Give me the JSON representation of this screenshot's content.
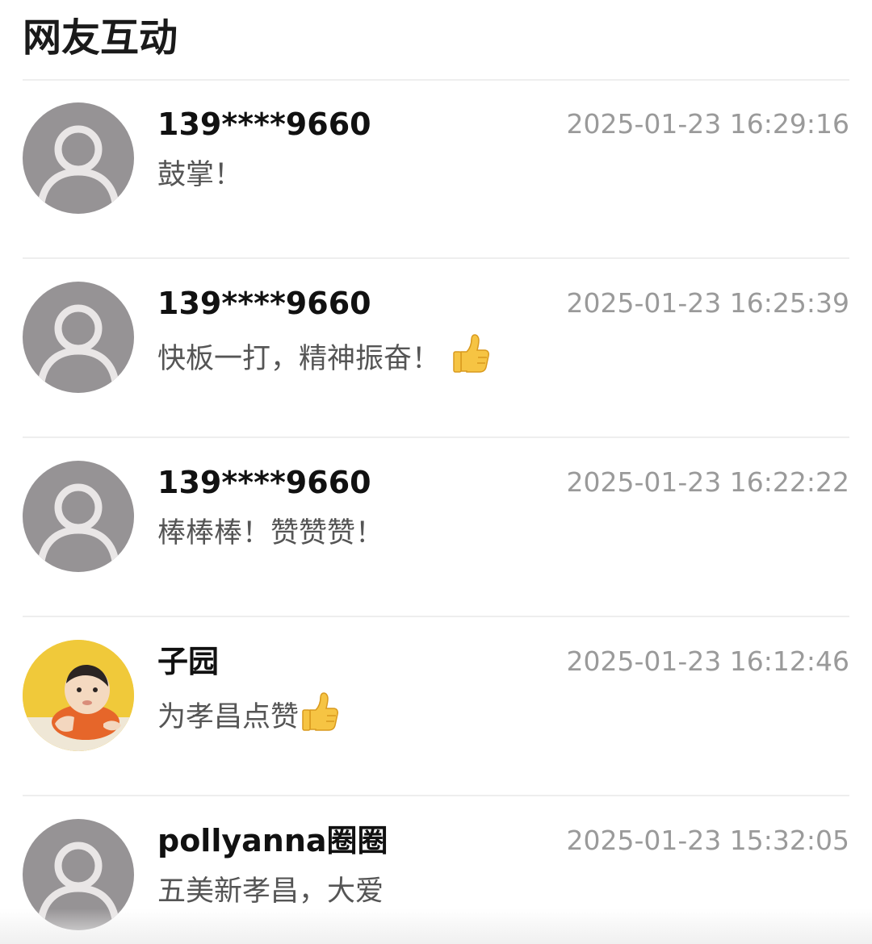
{
  "section": {
    "title": "网友互动"
  },
  "comments": [
    {
      "username": "139****9660",
      "timestamp": "2025-01-23 16:29:16",
      "text": "鼓掌！",
      "emoji": "",
      "avatar": "default-avatar-icon"
    },
    {
      "username": "139****9660",
      "timestamp": "2025-01-23 16:25:39",
      "text": "快板一打，精神振奋！",
      "emoji": "thumbs-up-icon",
      "avatar": "default-avatar-icon"
    },
    {
      "username": "139****9660",
      "timestamp": "2025-01-23 16:22:22",
      "text": "棒棒棒！赞赞赞！",
      "emoji": "",
      "avatar": "default-avatar-icon"
    },
    {
      "username": "子园",
      "timestamp": "2025-01-23 16:12:46",
      "text": "为孝昌点赞",
      "emoji": "thumbs-up-icon",
      "avatar": "baby-photo-avatar"
    },
    {
      "username": "pollyanna圈圈",
      "timestamp": "2025-01-23 15:32:05",
      "text": "五美新孝昌，大爱",
      "emoji": "",
      "avatar": "default-avatar-icon"
    }
  ],
  "colors": {
    "avatar_bg": "#969395",
    "avatar_person": "#e9e6e6",
    "divider": "#eeeeee",
    "timestamp": "#9a9a9a",
    "comment_text": "#555555",
    "username": "#111111",
    "thumb": "#f6c443"
  }
}
